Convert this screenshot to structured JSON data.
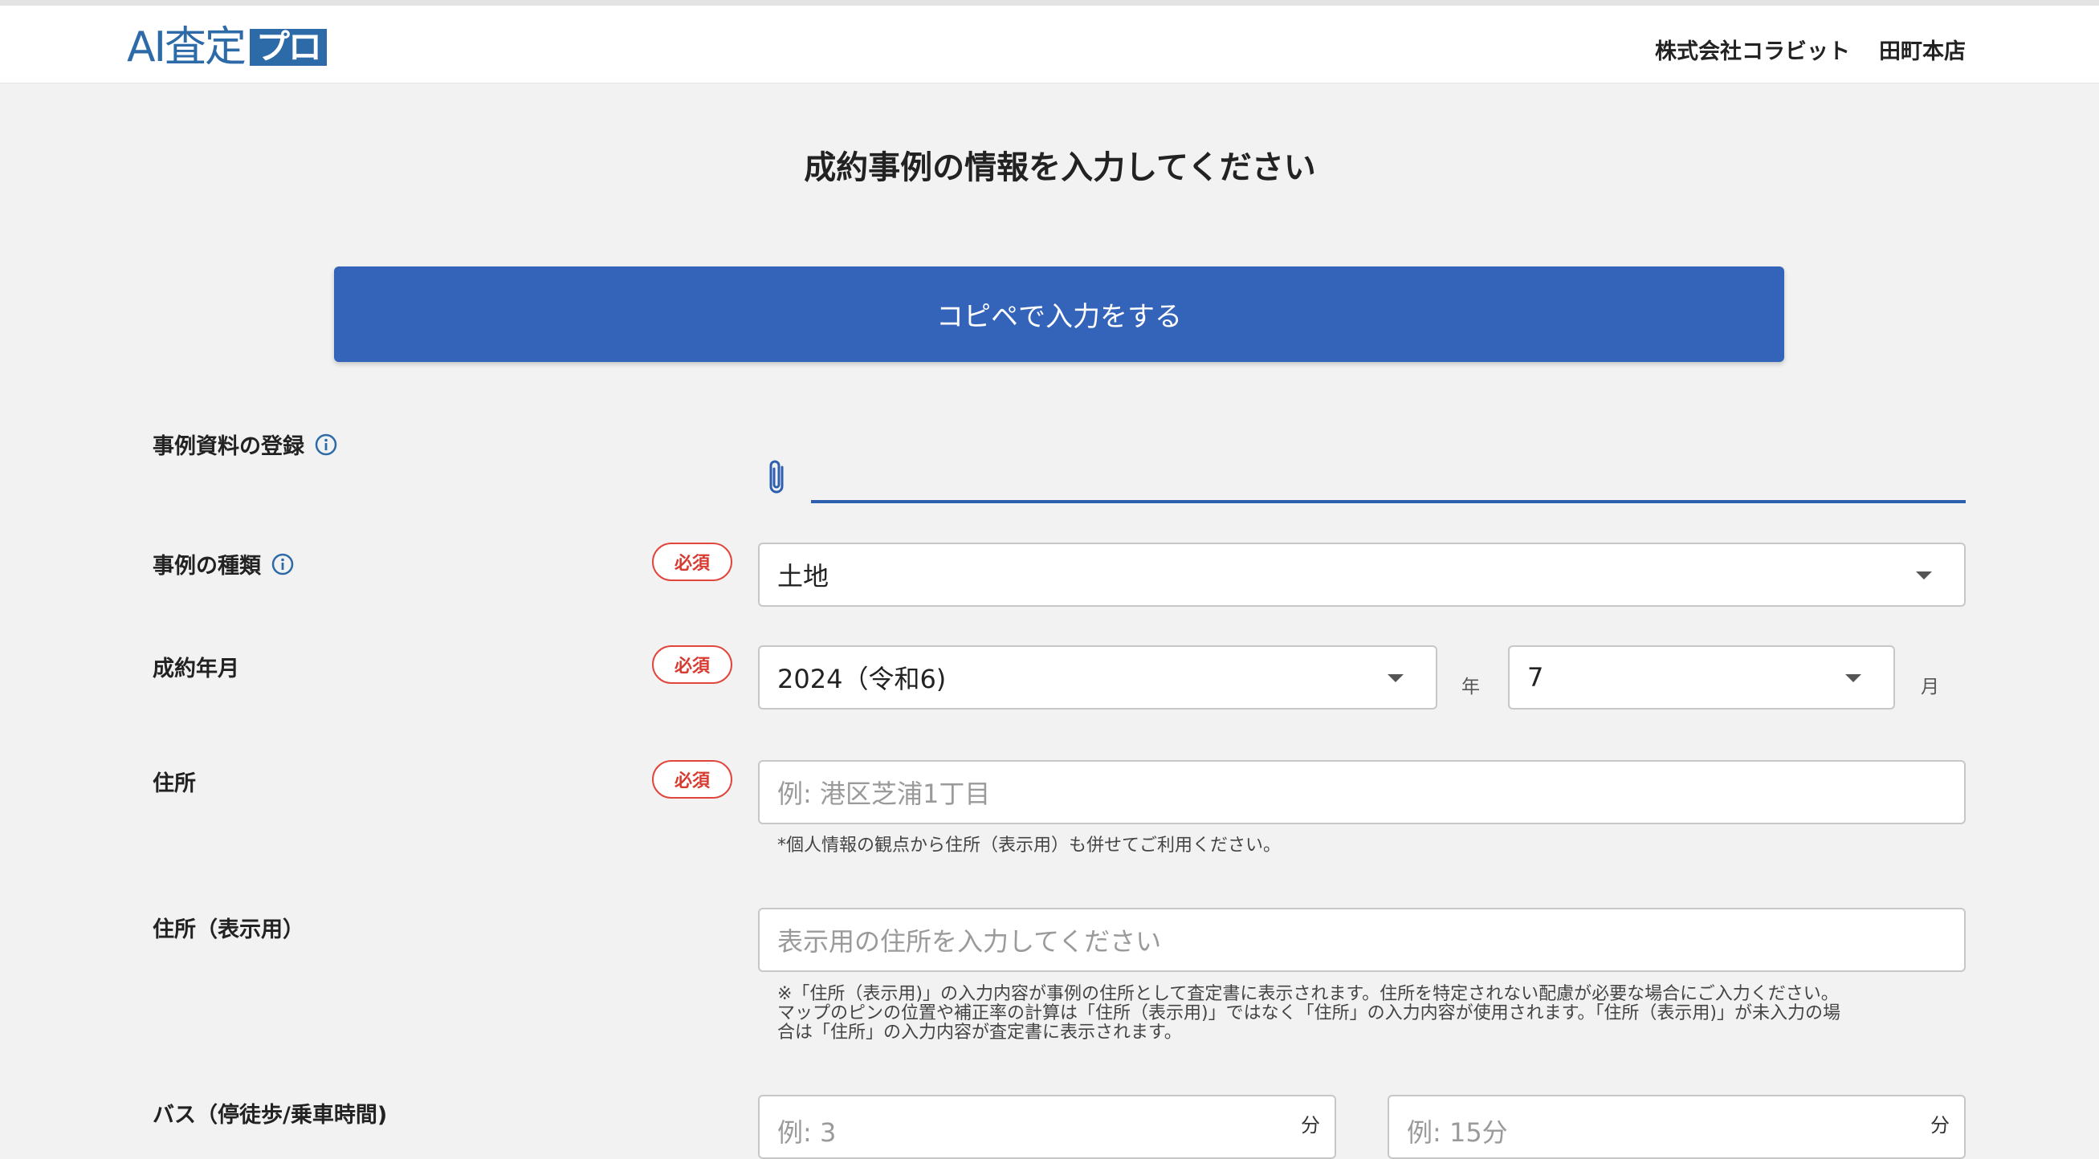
{
  "header": {
    "logo_text": "AI査定",
    "logo_box": "プロ",
    "company": "株式会社コラビット",
    "branch": "田町本店"
  },
  "page_title": "成約事例の情報を入力してください",
  "copy_button": "コピペで入力をする",
  "required_label": "必須",
  "fields": {
    "document": {
      "label": "事例資料の登録"
    },
    "type": {
      "label": "事例の種類",
      "value": "土地"
    },
    "contract_date": {
      "label": "成約年月",
      "year_value": "2024（令和6)",
      "year_unit": "年",
      "month_value": "7",
      "month_unit": "月"
    },
    "address": {
      "label": "住所",
      "placeholder": "例: 港区芝浦1丁目",
      "note": "*個人情報の観点から住所（表示用）も併せてご利用ください。"
    },
    "display_address": {
      "label": "住所（表示用）",
      "placeholder": "表示用の住所を入力してください",
      "note_1": "※「住所（表示用)」の入力内容が事例の住所として査定書に表示されます。住所を特定されない配慮が必要な場合にご入力ください。",
      "note_2": "マップのピンの位置や補正率の計算は「住所（表示用)」ではなく「住所」の入力内容が使用されます。「住所（表示用)」が未入力の場",
      "note_3": "合は「住所」の入力内容が査定書に表示されます。"
    },
    "bus": {
      "label": "バス（停徒歩/乗車時間)",
      "walk_placeholder": "例: 3",
      "walk_unit": "分",
      "ride_placeholder": "例: 15分",
      "ride_unit": "分"
    }
  },
  "colors": {
    "primary": "#3364b9",
    "required": "#e0463c",
    "logo": "#2d6aa8"
  }
}
